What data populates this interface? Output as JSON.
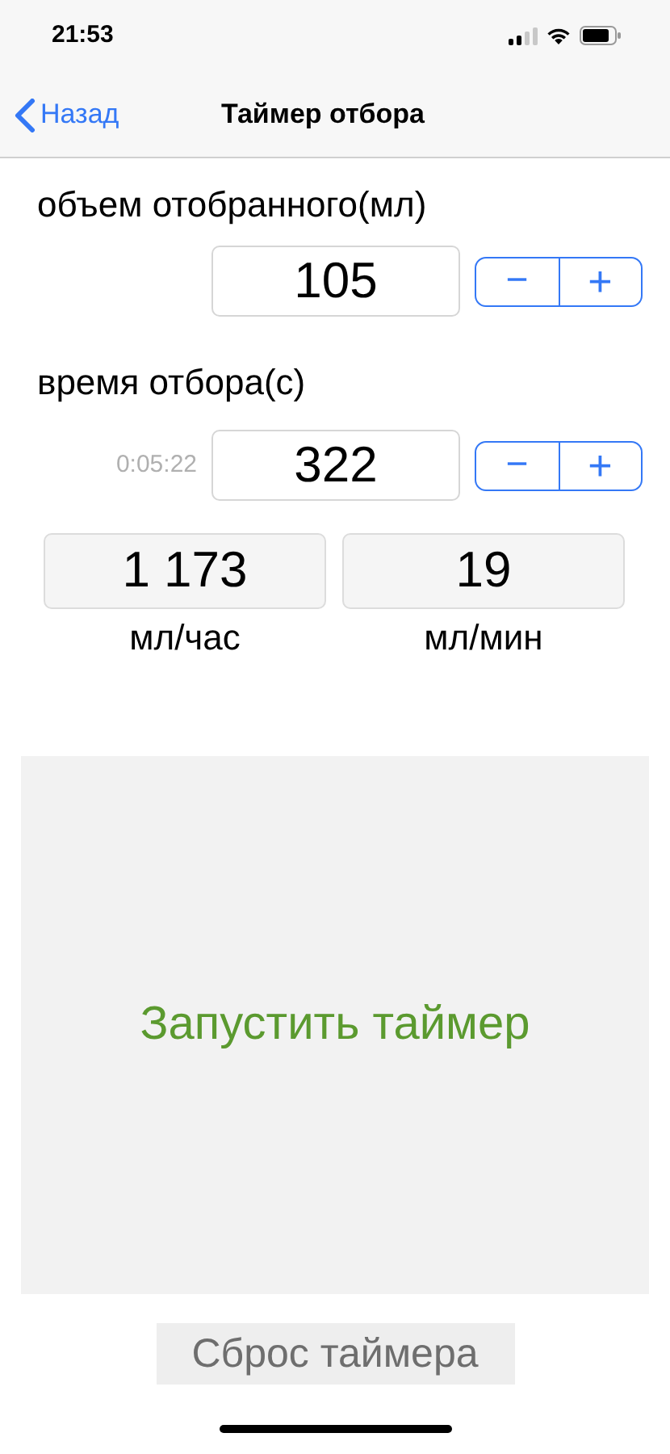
{
  "status_bar": {
    "time": "21:53"
  },
  "nav_bar": {
    "back": "Назад",
    "title": "Таймер отбора"
  },
  "volume": {
    "label": "объем отобранного(мл)",
    "value": "105",
    "minus": "−",
    "plus": "+"
  },
  "duration": {
    "label": "время отбора(с)",
    "hint": "0:05:22",
    "value": "322",
    "minus": "−",
    "plus": "+"
  },
  "results": [
    {
      "value": "1 173",
      "unit": "мл/час"
    },
    {
      "value": "19",
      "unit": "мл/мин"
    }
  ],
  "start_button": "Запустить таймер",
  "reset_button": "Сброс таймера"
}
